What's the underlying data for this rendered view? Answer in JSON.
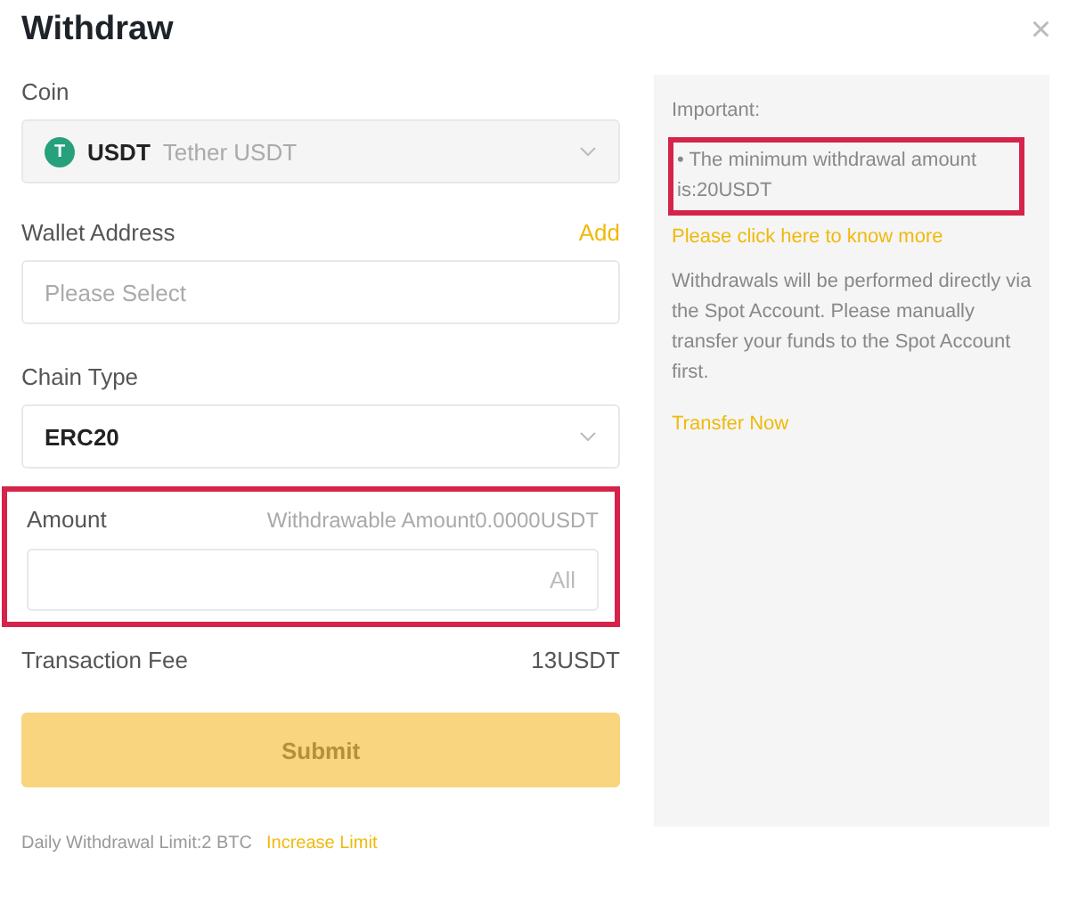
{
  "dialog": {
    "title": "Withdraw",
    "close": "×"
  },
  "coin": {
    "label": "Coin",
    "symbol": "USDT",
    "name": "Tether USDT",
    "icon_letter": "T"
  },
  "wallet": {
    "label": "Wallet Address",
    "action": "Add",
    "placeholder": "Please Select"
  },
  "chain": {
    "label": "Chain Type",
    "value": "ERC20"
  },
  "amount": {
    "label": "Amount",
    "available": "Withdrawable Amount0.0000USDT",
    "all": "All",
    "highlighted": true
  },
  "fee": {
    "label": "Transaction Fee",
    "value": "13USDT"
  },
  "submit": {
    "label": "Submit",
    "disabled": true
  },
  "limit": {
    "text": "Daily Withdrawal Limit:2 BTC",
    "link": "Increase Limit"
  },
  "notice": {
    "heading": "Important:",
    "minimum": "• The minimum withdrawal amount is:20USDT",
    "minimum_highlighted": true,
    "more_link": "Please click here to know more",
    "body": "Withdrawals will be performed directly via the Spot Account. Please manually transfer your funds to the Spot Account first.",
    "transfer_link": "Transfer Now"
  }
}
